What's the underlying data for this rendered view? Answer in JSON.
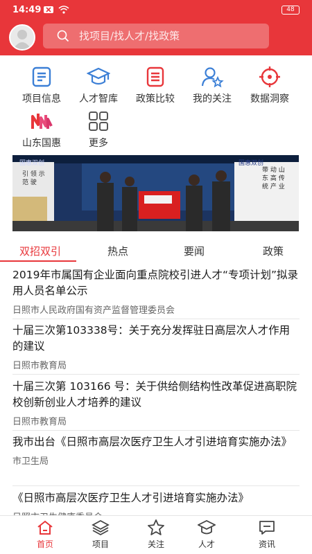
{
  "status_bar": {
    "time": "14:49",
    "battery": "48"
  },
  "search": {
    "placeholder": "找项目/找人才/找政策"
  },
  "quick_links": [
    {
      "label": "项目信息",
      "icon": "document-list-icon"
    },
    {
      "label": "人才智库",
      "icon": "graduation-cap-icon"
    },
    {
      "label": "政策比较",
      "icon": "policy-document-icon"
    },
    {
      "label": "我的关注",
      "icon": "user-star-icon"
    },
    {
      "label": "数据洞察",
      "icon": "target-icon"
    },
    {
      "label": "山东国惠",
      "icon": "shandong-guohui-logo"
    },
    {
      "label": "更多",
      "icon": "grid-icon"
    }
  ],
  "banner": {
    "brand": "国惠双创",
    "left_caption": "引 领 示 范 驶",
    "right_caption": "带 动 山 东 高 传 统 产 业"
  },
  "tabs": [
    "双招双引",
    "热点",
    "要闻",
    "政策"
  ],
  "news": [
    {
      "title": "2019年市属国有企业面向重点院校引进人才“专项计划”拟录用人员名单公示",
      "source": "日照市人民政府国有资产监督管理委员会"
    },
    {
      "title": "十届三次第103338号：关于充分发挥驻日高层次人才作用的建议",
      "source": "日照市教育局"
    },
    {
      "title": "十届三次第 103166 号：关于供给侧结构性改革促进高职院校创新创业人才培养的建议",
      "source": "日照市教育局"
    },
    {
      "title": "我市出台《日照市高层次医疗卫生人才引进培育实施办法》",
      "source": "市卫生局"
    },
    {
      "title": "《日照市高层次医疗卫生人才引进培育实施办法》",
      "source": "日照市卫生健康委员会"
    }
  ],
  "bottom_nav": [
    {
      "label": "首页",
      "icon": "home-icon"
    },
    {
      "label": "项目",
      "icon": "layers-icon"
    },
    {
      "label": "关注",
      "icon": "star-icon"
    },
    {
      "label": "人才",
      "icon": "graduation-cap-icon"
    },
    {
      "label": "资讯",
      "icon": "message-icon"
    }
  ],
  "colors": {
    "brand_red": "#e8363a",
    "icon_blue": "#3b7fd6",
    "icon_red": "#e8363a"
  }
}
